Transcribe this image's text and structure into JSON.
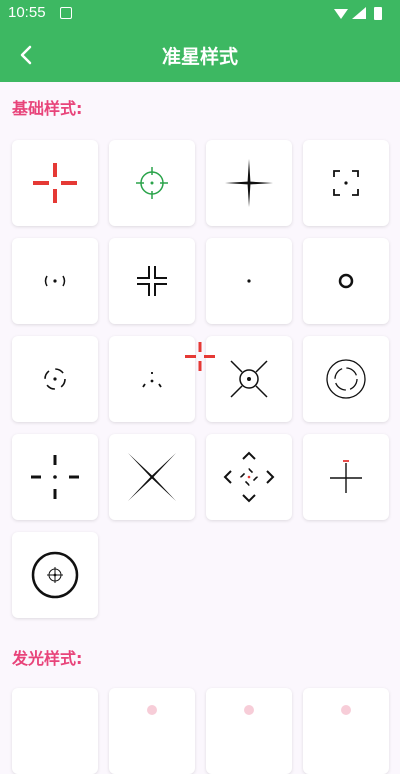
{
  "status": {
    "time": "10:55"
  },
  "appbar": {
    "title": "准星样式"
  },
  "sections": {
    "basic": "基础样式:",
    "glow": "发光样式:"
  },
  "icons": {
    "basic": [
      "crosshair-red-gap",
      "crosshair-green-scope",
      "crosshair-thin-plus",
      "crosshair-bracket-corners",
      "crosshair-paren-dot",
      "crosshair-quad-corners",
      "crosshair-dot",
      "crosshair-ring",
      "crosshair-dashed-circle",
      "crosshair-triangle-dots",
      "crosshair-x-circle",
      "crosshair-double-ring",
      "crosshair-dashed-plus",
      "crosshair-x-lines",
      "crosshair-diamond",
      "crosshair-red-tick-plus",
      "crosshair-scope-ring"
    ]
  },
  "colors": {
    "accent": "#3db862",
    "section": "#e8447a",
    "red": "#e53935",
    "green": "#2aa34a",
    "glow": "#f4b8c8"
  }
}
